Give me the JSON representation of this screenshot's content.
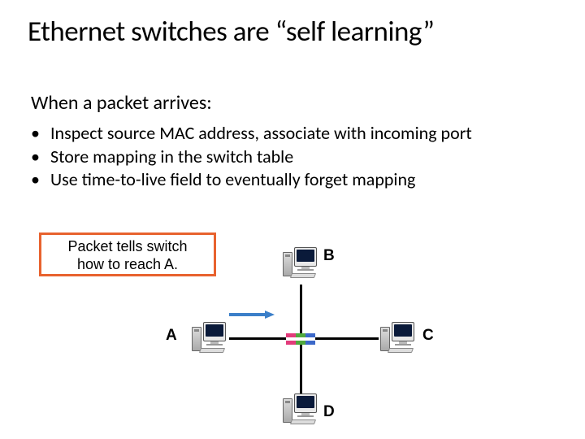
{
  "title": "Ethernet switches are “self learning”",
  "subtitle": "When a packet arrives:",
  "bullets": [
    "Inspect source MAC address, associate with incoming port",
    "Store mapping in the switch table",
    "Use time-to-live field to eventually forget mapping"
  ],
  "callout": {
    "line1": "Packet tells switch",
    "line2": "how to reach A."
  },
  "diagram": {
    "nodes": {
      "a": "A",
      "b": "B",
      "c": "C",
      "d": "D"
    }
  }
}
